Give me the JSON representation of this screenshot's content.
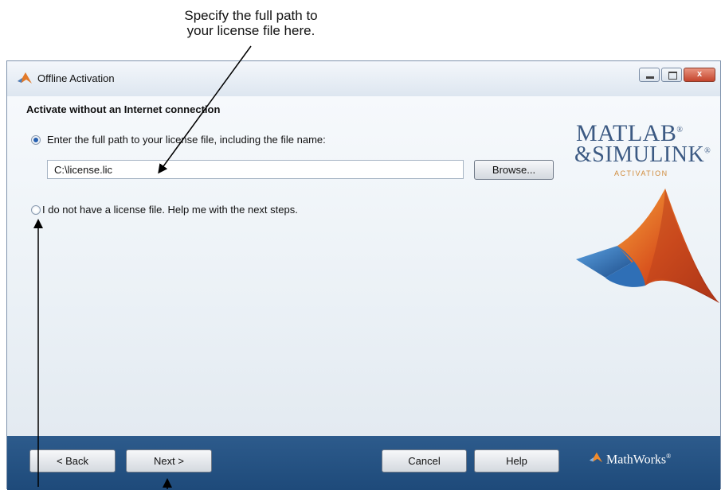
{
  "annotation": {
    "line1": "Specify the full path to",
    "line2": "your license file here."
  },
  "window": {
    "title": "Offline Activation",
    "controls": {
      "minimize": "",
      "maximize": "",
      "close": "x"
    }
  },
  "content": {
    "heading": "Activate without an Internet connection",
    "option_license": {
      "label": "Enter the full path to your license file, including the file name:",
      "checked": true
    },
    "path_input": {
      "value": "C:\\license.lic",
      "placeholder": ""
    },
    "browse_label": "Browse...",
    "option_no_license": {
      "label": "I do not have a license file.  Help me with the next steps.",
      "checked": false
    }
  },
  "branding": {
    "line1": "MATLAB",
    "line2": "&SIMULINK",
    "registered_mark": "®",
    "subtitle": "ACTIVATION",
    "icons": [
      "matlab-membrane-logo",
      "mathworks-logo"
    ],
    "colors": {
      "brand_blue": "#3c5a83",
      "accent_orange": "#d08a3a",
      "footer_blue": "#2d5b8c"
    }
  },
  "footer": {
    "back_label": "< Back",
    "next_label": "Next >",
    "cancel_label": "Cancel",
    "help_label": "Help",
    "company": "MathWorks",
    "company_mark": "®"
  }
}
